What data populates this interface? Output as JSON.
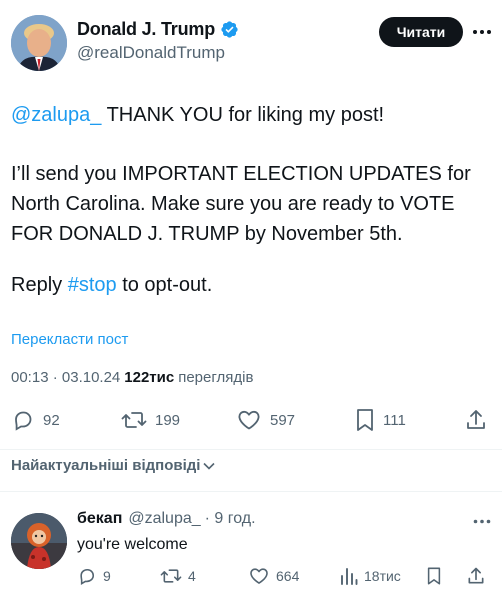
{
  "author": {
    "display_name": "Donald J. Trump",
    "handle": "@realDonaldTrump",
    "verified": true
  },
  "header_actions": {
    "follow_label": "Читати",
    "more_icon": "more-horizontal-icon"
  },
  "tweet": {
    "mention": "@zalupa_",
    "line1_rest": " THANK YOU for liking my post!",
    "paragraph2": "I’ll send you IMPORTANT ELECTION UPDATES for North Carolina. Make sure you are ready to VOTE FOR DONALD J. TRUMP by November 5th.",
    "reply_prefix": "Reply ",
    "hashtag": "#stop",
    "reply_suffix": " to opt-out."
  },
  "translate_label": "Перекласти пост",
  "meta": {
    "time": "00:13",
    "separator": " · ",
    "date": "03.10.24",
    "views_count": "122тис",
    "views_label": "переглядів"
  },
  "stats": {
    "replies": "92",
    "reposts": "199",
    "likes": "597",
    "bookmarks": "111"
  },
  "sort_label": "Найактуальніші відповіді",
  "reply": {
    "name": "бекап",
    "handle": "@zalupa_",
    "time": "· 9 год.",
    "text": "you're welcome",
    "stats": {
      "replies": "9",
      "reposts": "4",
      "likes": "664",
      "views": "18тис"
    }
  },
  "colors": {
    "link": "#1d9bf0",
    "text": "#0f1419",
    "secondary": "#536471",
    "button_bg": "#0f1419",
    "divider": "#eff3f4"
  }
}
